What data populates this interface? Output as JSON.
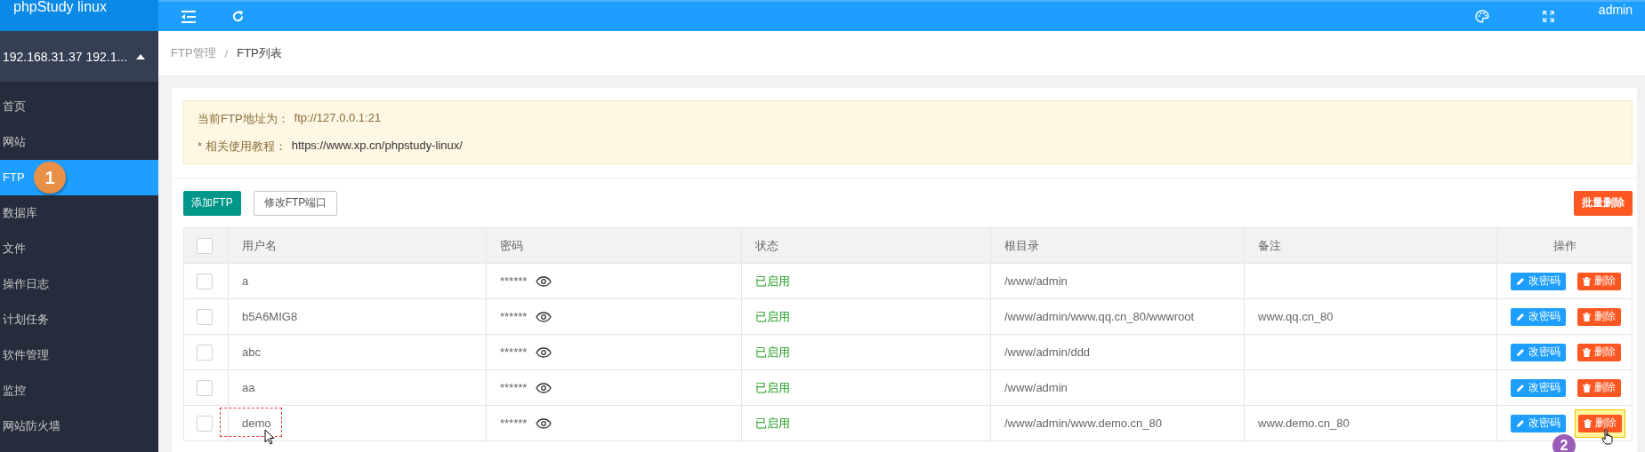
{
  "logo": "phpStudy linux",
  "top_user": "admin",
  "server": "192.168.31.37 192.1...",
  "sidebar": {
    "items": [
      {
        "label": "首页",
        "selected": false
      },
      {
        "label": "网站",
        "selected": false
      },
      {
        "label": "FTP",
        "selected": true,
        "marker": "1"
      },
      {
        "label": "数据库",
        "selected": false
      },
      {
        "label": "文件",
        "selected": false
      },
      {
        "label": "操作日志",
        "selected": false
      },
      {
        "label": "计划任务",
        "selected": false
      },
      {
        "label": "软件管理",
        "selected": false
      },
      {
        "label": "监控",
        "selected": false
      },
      {
        "label": "网站防火墙",
        "selected": false
      }
    ]
  },
  "breadcrumb": [
    "FTP管理",
    "FTP列表"
  ],
  "breadcrumb_separator": "/",
  "notice": {
    "address_label": "当前FTP地址为：",
    "address": "ftp://127.0.0.1:21",
    "tutorial_label": "* 相关使用教程：",
    "tutorial_link": "https://www.xp.cn/phpstudy-linux/"
  },
  "buttons": {
    "add": "添加FTP",
    "port": "修改FTP端口",
    "batch_delete": "批量删除"
  },
  "table": {
    "select_all": {
      "checked": false
    },
    "columns": [
      "用户名",
      "密码",
      "状态",
      "根目录",
      "备注",
      "操作"
    ],
    "rows": [
      {
        "checked": false,
        "username": "a",
        "password": "******",
        "status": "已启用",
        "root": "/www/admin",
        "note": "",
        "edit": "改密码",
        "delete": "删除",
        "name_marked": false,
        "delete_highlighted": false
      },
      {
        "checked": false,
        "username": "b5A6MIG8",
        "password": "******",
        "status": "已启用",
        "root": "/www/admin/www.qq.cn_80/wwwroot",
        "note": "www.qq.cn_80",
        "edit": "改密码",
        "delete": "删除",
        "name_marked": false,
        "delete_highlighted": false
      },
      {
        "checked": false,
        "username": "abc",
        "password": "******",
        "status": "已启用",
        "root": "/www/admin/ddd",
        "note": "",
        "edit": "改密码",
        "delete": "删除",
        "name_marked": false,
        "delete_highlighted": false
      },
      {
        "checked": false,
        "username": "aa",
        "password": "******",
        "status": "已启用",
        "root": "/www/admin",
        "note": "",
        "edit": "改密码",
        "delete": "删除",
        "name_marked": false,
        "delete_highlighted": false
      },
      {
        "checked": false,
        "username": "demo",
        "password": "******",
        "status": "已启用",
        "root": "/www/admin/www.demo.cn_80",
        "note": "www.demo.cn_80",
        "edit": "改密码",
        "delete": "删除",
        "name_marked": true,
        "delete_highlighted": true,
        "marker": "2"
      }
    ]
  }
}
